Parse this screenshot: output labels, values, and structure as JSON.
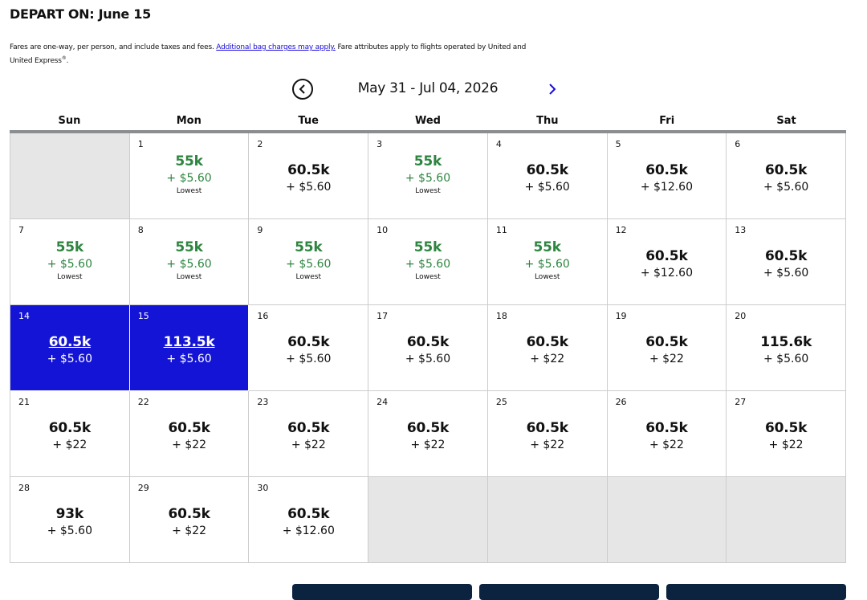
{
  "header": {
    "title": "DEPART ON: June 15",
    "disclaimer_before": "Fares are one-way, per person, and include taxes and fees. ",
    "disclaimer_link": "Additional bag charges may apply.",
    "disclaimer_after": " Fare attributes apply to flights operated by United and United Express",
    "disclaimer_sup": "®",
    "disclaimer_end": "."
  },
  "nav": {
    "range": "May 31 - Jul 04, 2026",
    "prev_icon": "chevron-left-circle-icon",
    "next_icon": "chevron-right-icon",
    "accent": "#1a0dd9"
  },
  "weekdays": [
    "Sun",
    "Mon",
    "Tue",
    "Wed",
    "Thu",
    "Fri",
    "Sat"
  ],
  "colors": {
    "lowest": "#2e8540",
    "selected": "#1414d6",
    "empty": "#e6e6e6"
  },
  "days": [
    {
      "empty": true
    },
    {
      "day": "1",
      "miles": "55k",
      "tax": "+ $5.60",
      "lowest": "Lowest"
    },
    {
      "day": "2",
      "miles": "60.5k",
      "tax": "+ $5.60"
    },
    {
      "day": "3",
      "miles": "55k",
      "tax": "+ $5.60",
      "lowest": "Lowest"
    },
    {
      "day": "4",
      "miles": "60.5k",
      "tax": "+ $5.60"
    },
    {
      "day": "5",
      "miles": "60.5k",
      "tax": "+ $12.60"
    },
    {
      "day": "6",
      "miles": "60.5k",
      "tax": "+ $5.60"
    },
    {
      "day": "7",
      "miles": "55k",
      "tax": "+ $5.60",
      "lowest": "Lowest"
    },
    {
      "day": "8",
      "miles": "55k",
      "tax": "+ $5.60",
      "lowest": "Lowest"
    },
    {
      "day": "9",
      "miles": "55k",
      "tax": "+ $5.60",
      "lowest": "Lowest"
    },
    {
      "day": "10",
      "miles": "55k",
      "tax": "+ $5.60",
      "lowest": "Lowest"
    },
    {
      "day": "11",
      "miles": "55k",
      "tax": "+ $5.60",
      "lowest": "Lowest"
    },
    {
      "day": "12",
      "miles": "60.5k",
      "tax": "+ $12.60"
    },
    {
      "day": "13",
      "miles": "60.5k",
      "tax": "+ $5.60"
    },
    {
      "day": "14",
      "miles": "60.5k",
      "tax": "+ $5.60",
      "selected": true
    },
    {
      "day": "15",
      "miles": "113.5k",
      "tax": "+ $5.60",
      "selected": true
    },
    {
      "day": "16",
      "miles": "60.5k",
      "tax": "+ $5.60"
    },
    {
      "day": "17",
      "miles": "60.5k",
      "tax": "+ $5.60"
    },
    {
      "day": "18",
      "miles": "60.5k",
      "tax": "+ $22"
    },
    {
      "day": "19",
      "miles": "60.5k",
      "tax": "+ $22"
    },
    {
      "day": "20",
      "miles": "115.6k",
      "tax": "+ $5.60"
    },
    {
      "day": "21",
      "miles": "60.5k",
      "tax": "+ $22"
    },
    {
      "day": "22",
      "miles": "60.5k",
      "tax": "+ $22"
    },
    {
      "day": "23",
      "miles": "60.5k",
      "tax": "+ $22"
    },
    {
      "day": "24",
      "miles": "60.5k",
      "tax": "+ $22"
    },
    {
      "day": "25",
      "miles": "60.5k",
      "tax": "+ $22"
    },
    {
      "day": "26",
      "miles": "60.5k",
      "tax": "+ $22"
    },
    {
      "day": "27",
      "miles": "60.5k",
      "tax": "+ $22"
    },
    {
      "day": "28",
      "miles": "93k",
      "tax": "+ $5.60"
    },
    {
      "day": "29",
      "miles": "60.5k",
      "tax": "+ $22"
    },
    {
      "day": "30",
      "miles": "60.5k",
      "tax": "+ $12.60"
    },
    {
      "empty": true
    },
    {
      "empty": true
    },
    {
      "empty": true
    },
    {
      "empty": true
    }
  ]
}
